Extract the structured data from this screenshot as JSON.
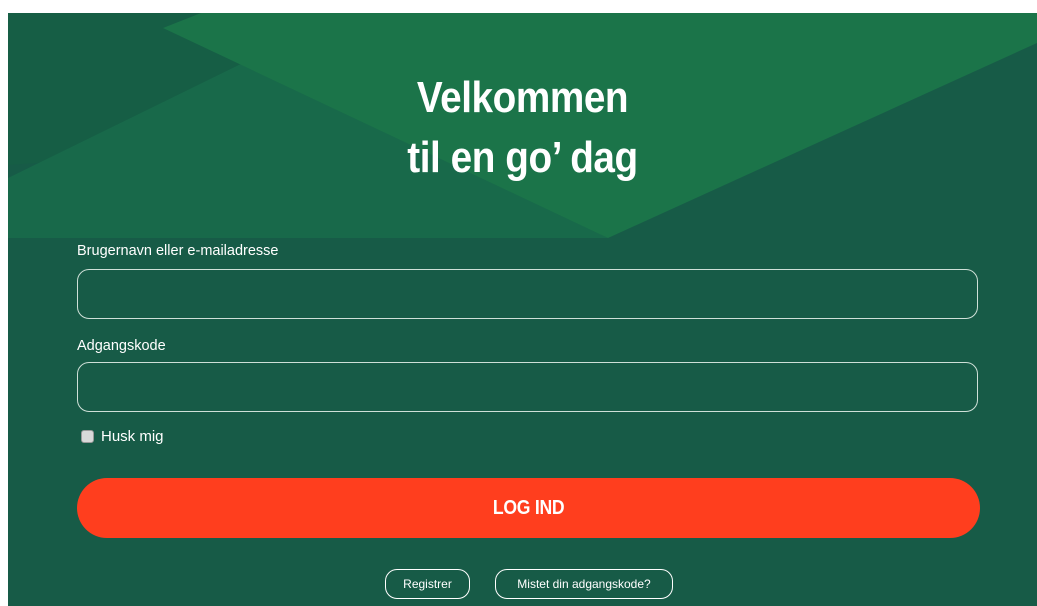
{
  "page": {
    "title_line1": "Velkommen",
    "title_line2": "til en go’ dag"
  },
  "form": {
    "username_label": "Brugernavn eller e-mailadresse",
    "username_value": "",
    "password_label": "Adgangskode",
    "password_value": "",
    "remember_label": "Husk mig",
    "remember_checked": false,
    "login_label": "LOG IND"
  },
  "links": {
    "register_label": "Registrer",
    "lost_password_label": "Mistet din adgangskode?"
  },
  "colors": {
    "background": "#175b47",
    "shape_light": "#1b7449",
    "shape_mid": "#18694a",
    "accent": "#ff3e1e",
    "text": "#ffffff"
  }
}
